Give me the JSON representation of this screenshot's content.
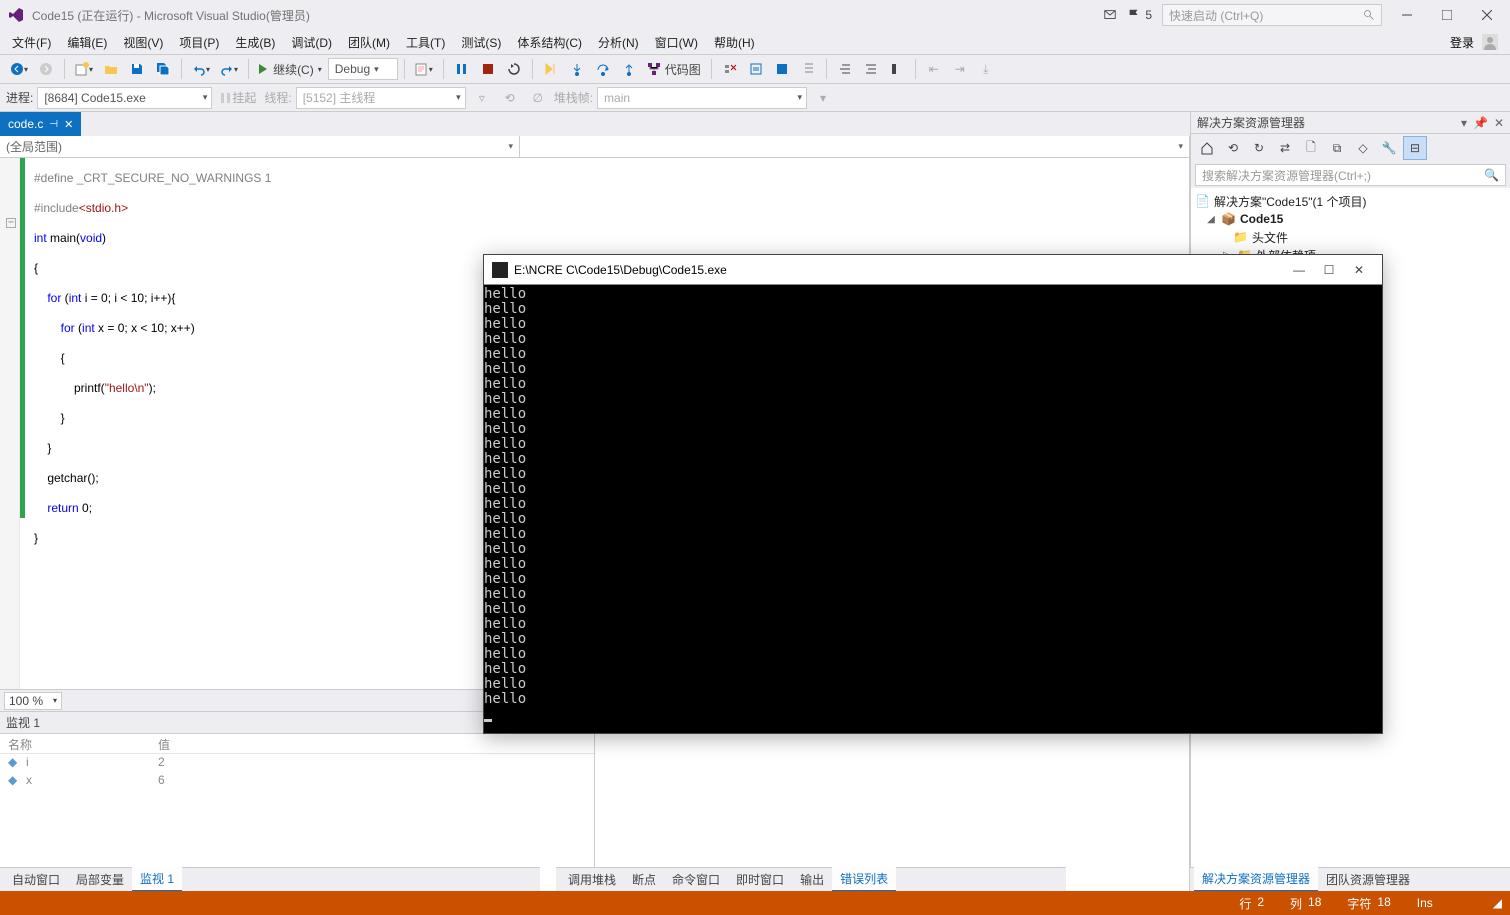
{
  "titlebar": {
    "title": "Code15 (正在运行) - Microsoft Visual Studio(管理员)",
    "notif_count": "5",
    "search_placeholder": "快速启动 (Ctrl+Q)"
  },
  "menubar": {
    "items": [
      "文件(F)",
      "编辑(E)",
      "视图(V)",
      "项目(P)",
      "生成(B)",
      "调试(D)",
      "团队(M)",
      "工具(T)",
      "测试(S)",
      "体系结构(C)",
      "分析(N)",
      "窗口(W)",
      "帮助(H)"
    ],
    "login": "登录"
  },
  "toolbar": {
    "continue": "继续(C)",
    "config": "Debug",
    "codemap": "代码图"
  },
  "toolbar2": {
    "process_lbl": "进程:",
    "process": "[8684] Code15.exe",
    "suspend": "挂起",
    "thread_lbl": "线程:",
    "thread": "[5152] 主线程",
    "stack_lbl": "堆栈帧:",
    "stack": "main"
  },
  "tab": {
    "name": "code.c"
  },
  "scope": {
    "left": "(全局范围)"
  },
  "code": {
    "l1_a": "#define",
    "l1_b": " _CRT_SECURE_NO_WARNINGS 1",
    "l2_a": "#include",
    "l2_b": "<stdio.h>",
    "l3_a": "int",
    "l3_b": " main(",
    "l3_c": "void",
    "l3_d": ")",
    "l4": "{",
    "l5_a": "    for",
    "l5_b": " (",
    "l5_c": "int",
    "l5_d": " i = 0; i < 10; i++){",
    "l6_a": "        for",
    "l6_b": " (",
    "l6_c": "int",
    "l6_d": " x = 0; x < 10; x++)",
    "l7": "        {",
    "l8_a": "            printf(",
    "l8_b": "\"hello\\n\"",
    "l8_c": ");",
    "l9": "        }",
    "l10": "    }",
    "l11": "    getchar();",
    "l12_a": "    return",
    "l12_b": " 0;",
    "l13": "}"
  },
  "zoom": "100 %",
  "watch": {
    "title": "监视 1",
    "col_name": "名称",
    "col_val": "值",
    "rows": [
      {
        "n": "i",
        "v": "2"
      },
      {
        "n": "x",
        "v": "6"
      }
    ]
  },
  "bottom_tabs_left": [
    "自动窗口",
    "局部变量",
    "监视 1"
  ],
  "bottom_tabs_right": [
    "调用堆栈",
    "断点",
    "命令窗口",
    "即时窗口",
    "输出",
    "错误列表"
  ],
  "side": {
    "title": "解决方案资源管理器",
    "search_ph": "搜索解决方案资源管理器(Ctrl+;)",
    "sol": "解决方案\"Code15\"(1 个项目)",
    "proj": "Code15",
    "hdr": "头文件",
    "ext": "外部依赖项"
  },
  "side_tabs": [
    "解决方案资源管理器",
    "团队资源管理器"
  ],
  "status": {
    "line_lbl": "行",
    "line": "2",
    "col_lbl": "列",
    "col": "18",
    "char_lbl": "字符",
    "char": "18",
    "ins": "Ins"
  },
  "console": {
    "title": "E:\\NCRE C\\Code15\\Debug\\Code15.exe",
    "line": "hello",
    "count": 28
  }
}
